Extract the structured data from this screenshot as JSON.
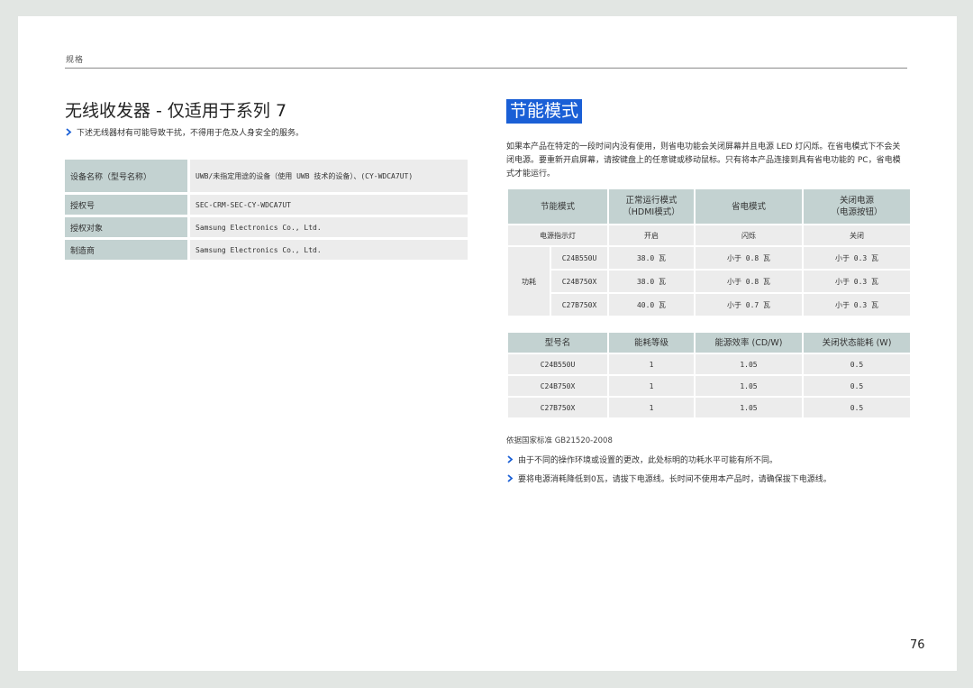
{
  "header": {
    "section": "规格"
  },
  "left": {
    "title": "无线收发器 - 仅适用于系列 7",
    "note": "下述无线器材有可能导致干扰，不得用于危及人身安全的服务。",
    "spec_rows": [
      {
        "key": "设备名称（型号名称）",
        "value": "UWB/未指定用途的设备（使用 UWB 技术的设备）、(CY-WDCA7UT)"
      },
      {
        "key": "授权号",
        "value": "SEC-CRM-SEC-CY-WDCA7UT"
      },
      {
        "key": "授权对象",
        "value": "Samsung Electronics Co., Ltd."
      },
      {
        "key": "制造商",
        "value": "Samsung Electronics Co., Ltd."
      }
    ]
  },
  "right": {
    "title": "节能模式",
    "intro": "如果本产品在特定的一段时间内没有使用，则省电功能会关闭屏幕并且电源 LED 灯闪烁。在省电模式下不会关闭电源。要重新开启屏幕，请按键盘上的任意键或移动鼠标。只有将本产品连接到具有省电功能的 PC，省电模式才能运行。",
    "power_table": {
      "headers": [
        "节能模式",
        "正常运行模式\n（HDMI模式）",
        "省电模式",
        "关闭电源\n（电源按钮）"
      ],
      "indicator_row": {
        "label": "电源指示灯",
        "values": [
          "开启",
          "闪烁",
          "关闭"
        ]
      },
      "consumption_label": "功耗",
      "consumption_rows": [
        {
          "model": "C24B550U",
          "values": [
            "38.0 瓦",
            "小于 0.8 瓦",
            "小于 0.3 瓦"
          ]
        },
        {
          "model": "C24B750X",
          "values": [
            "38.0 瓦",
            "小于 0.8 瓦",
            "小于 0.3 瓦"
          ]
        },
        {
          "model": "C27B750X",
          "values": [
            "40.0 瓦",
            "小于 0.7 瓦",
            "小于 0.3 瓦"
          ]
        }
      ]
    },
    "efficiency_table": {
      "headers": [
        "型号名",
        "能耗等级",
        "能源效率 (CD/W)",
        "关闭状态能耗 (W)"
      ],
      "rows": [
        [
          "C24B550U",
          "1",
          "1.05",
          "0.5"
        ],
        [
          "C24B750X",
          "1",
          "1.05",
          "0.5"
        ],
        [
          "C27B750X",
          "1",
          "1.05",
          "0.5"
        ]
      ]
    },
    "standard": "依据国家标准 GB21520-2008",
    "notes": [
      "由于不同的操作环境或设置的更改，此处标明的功耗水平可能有所不同。",
      "要将电源消耗降低到0瓦，请拔下电源线。长时间不使用本产品时，请确保拔下电源线。"
    ]
  },
  "page_number": "76",
  "colors": {
    "header_cell": "#c3d2d1",
    "body_cell": "#ececec",
    "title_highlight": "#1a5fd6",
    "note_chevron": "#1a5fd6"
  }
}
